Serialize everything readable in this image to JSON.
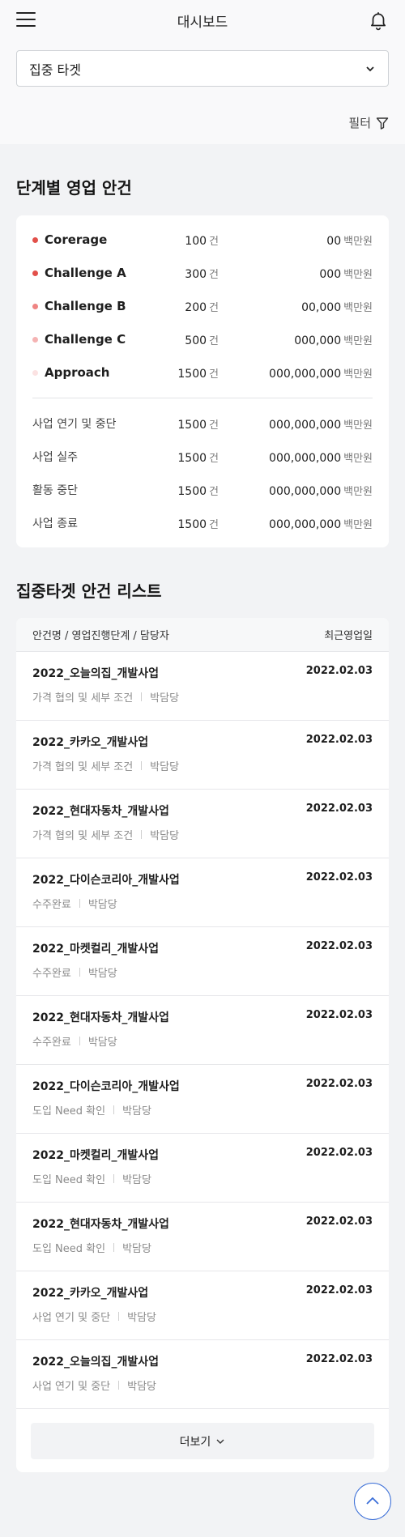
{
  "header": {
    "title": "대시보드"
  },
  "select": {
    "value": "집중 타겟"
  },
  "filter": {
    "label": "필터"
  },
  "stages": {
    "title": "단계별 영업 안건",
    "count_unit": "건",
    "amount_unit": "백만원",
    "primary": [
      {
        "name": "Corerage",
        "count": "100",
        "amount": "00",
        "color": "#e2504a"
      },
      {
        "name": "Challenge A",
        "count": "300",
        "amount": "000",
        "color": "#e2504a"
      },
      {
        "name": "Challenge B",
        "count": "200",
        "amount": "00,000",
        "color": "#ef8483"
      },
      {
        "name": "Challenge C",
        "count": "500",
        "amount": "000,000",
        "color": "#f5b3b3"
      },
      {
        "name": "Approach",
        "count": "1500",
        "amount": "000,000,000",
        "color": "#fbe2e2"
      }
    ],
    "secondary": [
      {
        "name": "사업 연기 및 중단",
        "count": "1500",
        "amount": "000,000,000"
      },
      {
        "name": "사업 실주",
        "count": "1500",
        "amount": "000,000,000"
      },
      {
        "name": "활동 중단",
        "count": "1500",
        "amount": "000,000,000"
      },
      {
        "name": "사업 종료",
        "count": "1500",
        "amount": "000,000,000"
      }
    ]
  },
  "list": {
    "title": "집중타겟 안건 리스트",
    "header_left": "안건명 / 영업진행단계 / 담당자",
    "header_right": "최근영업일",
    "items": [
      {
        "title": "2022_오늘의집_개발사업",
        "stage": "가격 협의 및 세부 조건",
        "manager": "박담당",
        "date": "2022.02.03"
      },
      {
        "title": "2022_카카오_개발사업",
        "stage": "가격 협의 및 세부 조건",
        "manager": "박담당",
        "date": "2022.02.03"
      },
      {
        "title": "2022_현대자동차_개발사업",
        "stage": "가격 협의 및 세부 조건",
        "manager": "박담당",
        "date": "2022.02.03"
      },
      {
        "title": "2022_다이슨코리아_개발사업",
        "stage": "수주완료",
        "manager": "박담당",
        "date": "2022.02.03"
      },
      {
        "title": "2022_마켓컬리_개발사업",
        "stage": "수주완료",
        "manager": "박담당",
        "date": "2022.02.03"
      },
      {
        "title": "2022_현대자동차_개발사업",
        "stage": "수주완료",
        "manager": "박담당",
        "date": "2022.02.03"
      },
      {
        "title": "2022_다이슨코리아_개발사업",
        "stage": "도입 Need 확인",
        "manager": "박담당",
        "date": "2022.02.03"
      },
      {
        "title": "2022_마켓컬리_개발사업",
        "stage": "도입 Need 확인",
        "manager": "박담당",
        "date": "2022.02.03"
      },
      {
        "title": "2022_현대자동차_개발사업",
        "stage": "도입 Need 확인",
        "manager": "박담당",
        "date": "2022.02.03"
      },
      {
        "title": "2022_카카오_개발사업",
        "stage": "사업 연기 및 중단",
        "manager": "박담당",
        "date": "2022.02.03"
      },
      {
        "title": "2022_오늘의집_개발사업",
        "stage": "사업 연기 및 중단",
        "manager": "박담당",
        "date": "2022.02.03"
      }
    ],
    "more_label": "더보기"
  },
  "icons": {
    "menu": "hamburger-icon",
    "notification": "bell-icon",
    "dropdown": "chevron-down-icon",
    "filter": "filter-icon",
    "scroll_top": "chevron-up-icon"
  }
}
